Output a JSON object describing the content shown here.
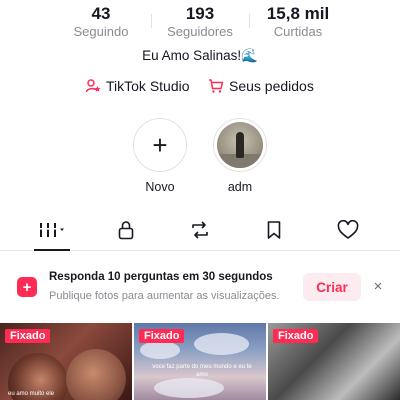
{
  "stats": [
    {
      "value": "43",
      "label": "Seguindo"
    },
    {
      "value": "193",
      "label": "Seguidores"
    },
    {
      "value": "15,8 mil",
      "label": "Curtidas"
    }
  ],
  "bio": {
    "text": "Eu Amo Salinas!",
    "emoji": "🌊"
  },
  "links": {
    "studio": "TikTok Studio",
    "orders": "Seus pedidos"
  },
  "highlights": [
    {
      "name": "Novo",
      "icon": "plus-icon"
    },
    {
      "name": "adm",
      "icon": "story-thumbnail"
    }
  ],
  "tabs": [
    {
      "icon": "grid-icon",
      "active": true
    },
    {
      "icon": "lock-icon"
    },
    {
      "icon": "repost-icon"
    },
    {
      "icon": "bookmark-icon"
    },
    {
      "icon": "heart-icon"
    }
  ],
  "promo": {
    "title": "Responda 10 perguntas em 30 segundos",
    "subtitle": "Publique fotos para aumentar as visualizações.",
    "cta": "Criar",
    "close": "×"
  },
  "videos": [
    {
      "badge": "Fixado",
      "caption": "eu amo muito ele"
    },
    {
      "badge": "Fixado",
      "caption": "voce faz parte do meu mundo e eu te amo"
    },
    {
      "badge": "Fixado"
    }
  ],
  "colors": {
    "accent": "#fe2c55",
    "text": "#161823",
    "muted": "#8a8b91"
  }
}
